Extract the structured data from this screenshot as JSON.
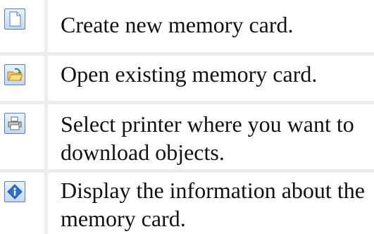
{
  "items": [
    {
      "icon": "new-document-icon",
      "text": "Create new memory card."
    },
    {
      "icon": "open-folder-icon",
      "text": "Open existing memory card."
    },
    {
      "icon": "printer-icon",
      "text": "Select printer where you want to download objects."
    },
    {
      "icon": "info-icon",
      "text": "Display the information about the memory card."
    }
  ]
}
